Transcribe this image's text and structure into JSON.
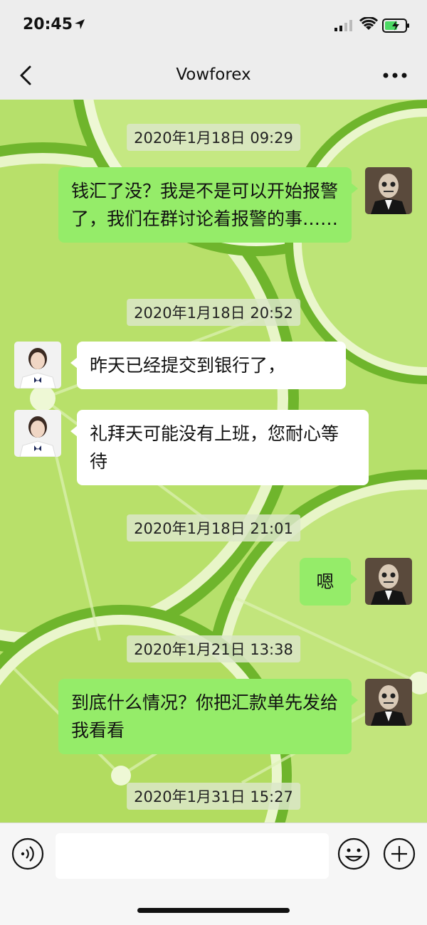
{
  "status": {
    "time": "20:45"
  },
  "nav": {
    "title": "Vowforex"
  },
  "messages": [
    {
      "timestamp": "2020年1月18日 09:29"
    },
    {
      "side": "me",
      "text": "钱汇了没？我是不是可以开始报警了，我们在群讨论着报警的事……"
    },
    {
      "timestamp": "2020年1月18日 20:52"
    },
    {
      "side": "them",
      "text": "昨天已经提交到银行了，"
    },
    {
      "side": "them",
      "text": "礼拜天可能没有上班，您耐心等待"
    },
    {
      "timestamp": "2020年1月18日 21:01"
    },
    {
      "side": "me",
      "text": "嗯"
    },
    {
      "timestamp": "2020年1月21日 13:38"
    },
    {
      "side": "me",
      "text": "到底什么情况？你把汇款单先发给我看看"
    },
    {
      "timestamp": "2020年1月31日 15:27"
    }
  ],
  "input": {
    "placeholder": ""
  },
  "icons": {
    "back": "chevron-left-icon",
    "more": "more-dots-icon",
    "voice": "voice-icon",
    "emoji": "emoji-icon",
    "plus": "plus-icon"
  },
  "colors": {
    "my_bubble": "#95ec69",
    "their_bubble": "#ffffff",
    "bar": "#ededed"
  }
}
